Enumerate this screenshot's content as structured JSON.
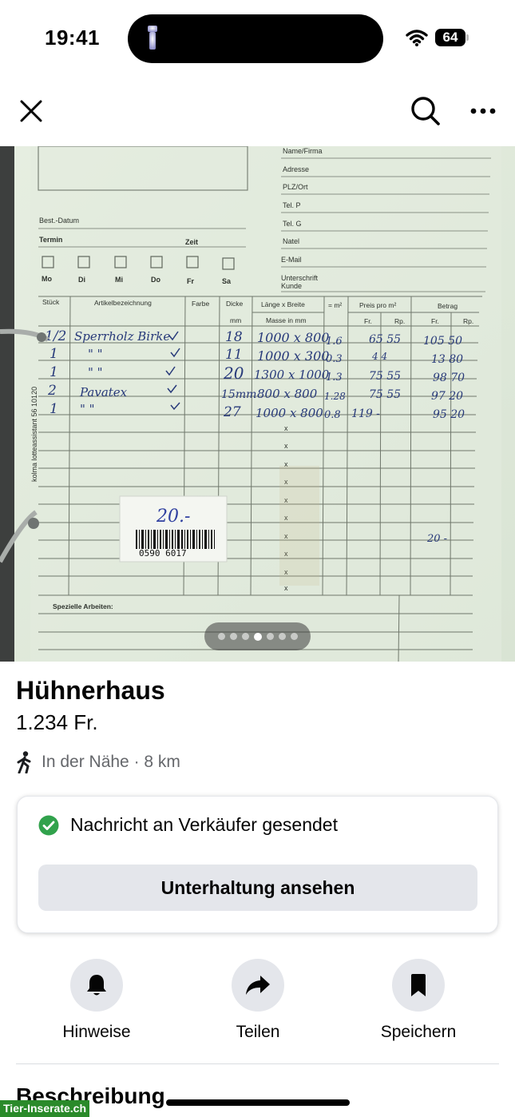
{
  "status_bar": {
    "time": "19:41",
    "battery": "64"
  },
  "topbar": {
    "close_icon": "close-icon",
    "search_icon": "search-icon",
    "more_icon": "more-icon"
  },
  "photo": {
    "form_labels": {
      "name": "Name/Firma",
      "address": "Adresse",
      "city": "PLZ/Ort",
      "tel_p": "Tel. P",
      "tel_g": "Tel. G",
      "natel": "Natel",
      "email": "E-Mail",
      "signature_1": "Unterschrift",
      "signature_2": "Kunde",
      "order_date": "Best.-Datum",
      "appointment": "Termin",
      "time": "Zeit",
      "days": [
        "Mo",
        "Di",
        "Mi",
        "Do",
        "Fr",
        "Sa"
      ],
      "col_qty": "Stück",
      "col_article": "Artikelbezeichnung",
      "col_color": "Farbe",
      "col_thickness": "Dicke",
      "col_mm": "mm",
      "col_size": "Länge  x  Breite",
      "col_size_sub": "Masse in mm",
      "col_m2": "= m²",
      "col_price": "Preis pro m²",
      "col_amount": "Betrag",
      "fr": "Fr.",
      "rp": "Rp.",
      "special": "Spezielle Arbeiten:",
      "side_text": "kolma lotteassistant  56 10120"
    },
    "rows": [
      {
        "qty": "1/2",
        "article": "Sperrholz Birke",
        "thick": "18",
        "size": "1000 x 800",
        "m2": "1.6",
        "price": "65 55",
        "amount": "105 50"
      },
      {
        "qty": "1",
        "article": "\"        \"",
        "thick": "11",
        "size": "1000 x 300",
        "m2": "0.3",
        "price": "4   4",
        "amount": "13 80"
      },
      {
        "qty": "1",
        "article": "\"        \"",
        "thick": "20",
        "size": "1300 x 1000",
        "m2": "1.3",
        "price": "75 55",
        "amount": "98 70"
      },
      {
        "qty": "2",
        "article": "Pavatex",
        "thick": "15mm",
        "size": "800 x 800",
        "m2": "1.28",
        "price": "75 55",
        "amount": "97 20"
      },
      {
        "qty": "1",
        "article": "\"        \"",
        "thick": "27",
        "size": "1000 x 800",
        "m2": "0.8",
        "price": "119  -",
        "amount": "95 20"
      }
    ],
    "sticker_price": "20.-",
    "barcode_number": "0590 6017",
    "note_total": "20 -",
    "dots_total": 7,
    "dots_active_index": 3
  },
  "listing": {
    "title": "Hühnerhaus",
    "price": "1.234 Fr.",
    "location": "In der Nähe · 8 km",
    "location_icon": "walking-person-icon"
  },
  "message_card": {
    "status_text": "Nachricht an Verkäufer gesendet",
    "status_icon": "check-circle-icon",
    "button_label": "Unterhaltung ansehen",
    "accent_color": "#31a24c"
  },
  "actions": [
    {
      "label": "Hinweise",
      "icon": "bell-icon"
    },
    {
      "label": "Teilen",
      "icon": "share-arrow-icon"
    },
    {
      "label": "Speichern",
      "icon": "bookmark-icon"
    }
  ],
  "section_title": "Beschreibung",
  "watermark": "Tier-Inserate.ch"
}
